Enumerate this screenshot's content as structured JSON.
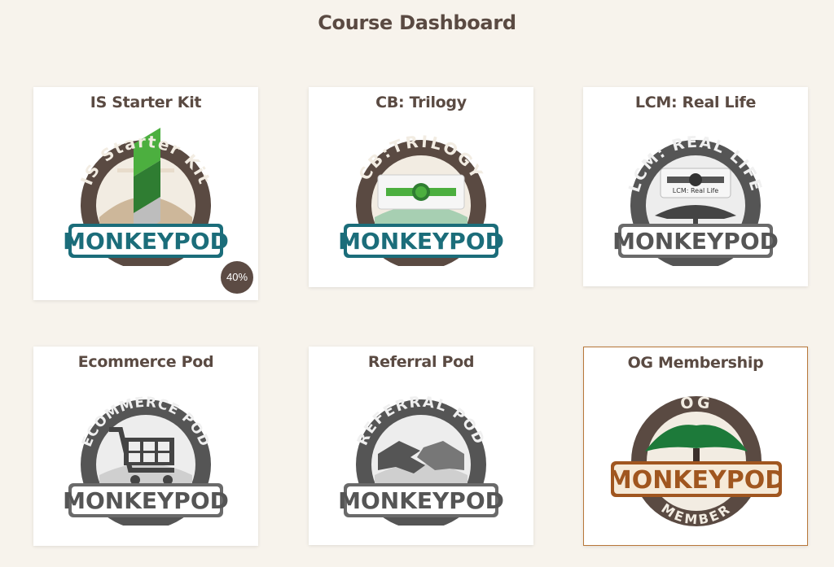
{
  "page": {
    "title": "Course Dashboard"
  },
  "courses": [
    {
      "title": "IS Starter Kit",
      "ring_text": "IS Starter Kit",
      "banner_text": "MONKEYPOD",
      "icon": "starter-kit-logo-icon",
      "progress": "40%",
      "colors": {
        "ring": "#5a4a42",
        "banner": "#1b6d7a",
        "accent": "#4caf3f"
      }
    },
    {
      "title": "CB: Trilogy",
      "ring_text": "CB:TRILOGY",
      "banner_text": "MONKEYPOD",
      "icon": "clock-connector-icon",
      "colors": {
        "ring": "#5a4a42",
        "banner": "#1b6d7a",
        "accent": "#4caf3f"
      }
    },
    {
      "title": "LCM: Real Life",
      "ring_text": "LCM: REAL LIFE",
      "inner_label": "LCM: Real Life",
      "banner_text": "MONKEYPOD",
      "icon": "tree-connector-icon",
      "colors": {
        "ring": "#555555",
        "banner": "#6a6a6a",
        "accent": "#444444"
      }
    },
    {
      "title": "Ecommerce Pod",
      "ring_text": "ECOMMERCE POD",
      "banner_text": "MONKEYPOD",
      "icon": "shopping-cart-icon",
      "colors": {
        "ring": "#555555",
        "banner": "#6a6a6a",
        "accent": "#555555"
      }
    },
    {
      "title": "Referral Pod",
      "ring_text": "REFERRAL POD",
      "banner_text": "MONKEYPOD",
      "icon": "handshake-icon",
      "colors": {
        "ring": "#555555",
        "banner": "#6a6a6a",
        "accent": "#555555"
      }
    },
    {
      "title": "OG Membership",
      "ring_text": "OG",
      "ring_bottom_text": "MEMBER",
      "banner_text": "MONKEYPOD",
      "icon": "tree-icon",
      "selected": true,
      "colors": {
        "ring": "#5a4a42",
        "banner": "#a0561f",
        "accent": "#1d7a3a"
      }
    }
  ]
}
